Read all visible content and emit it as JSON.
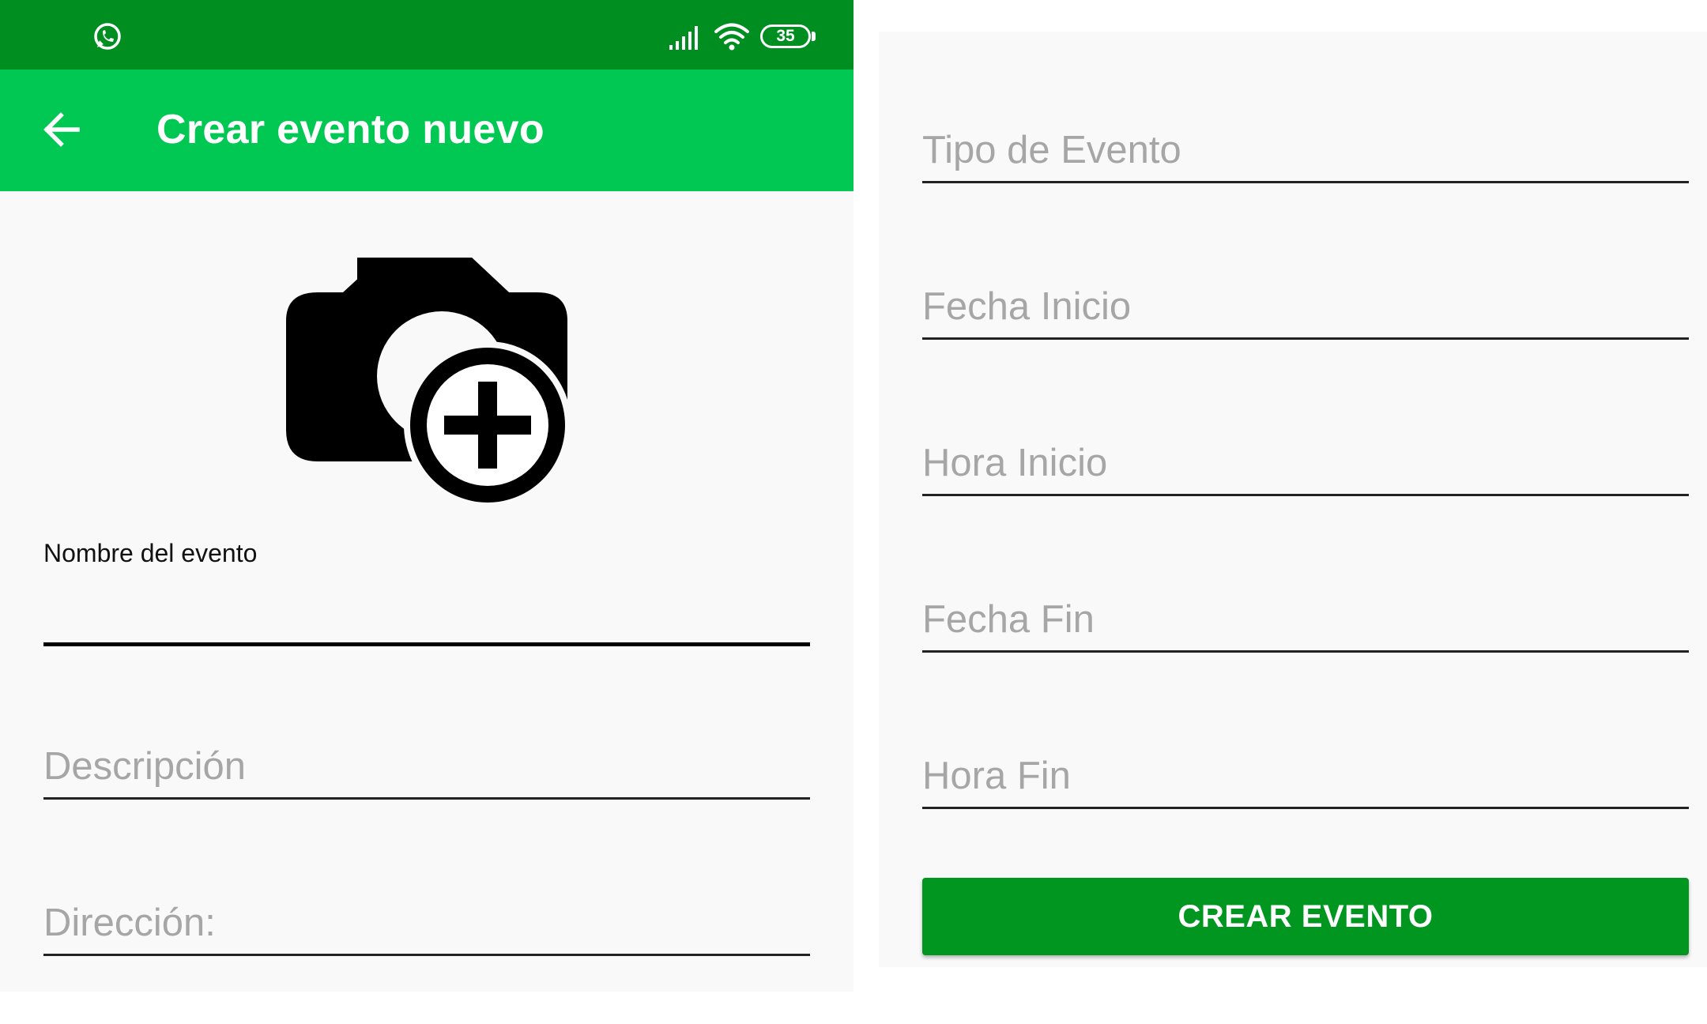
{
  "status_bar": {
    "battery_level": "35",
    "icons": [
      "whatsapp-icon",
      "signal-icon",
      "wifi-icon",
      "battery-icon"
    ]
  },
  "app_bar": {
    "title": "Crear evento nuevo",
    "back_icon": "arrow-left-icon"
  },
  "photo_picker": {
    "icon": "add-a-photo-icon"
  },
  "left_form": {
    "name_label": "Nombre del evento",
    "name_value": "",
    "description_placeholder": "Descripción",
    "address_placeholder": "Dirección:"
  },
  "right_form": {
    "type_placeholder": "Tipo de Evento",
    "start_date_placeholder": "Fecha Inicio",
    "start_time_placeholder": "Hora Inicio",
    "end_date_placeholder": "Fecha Fin",
    "end_time_placeholder": "Hora Fin",
    "submit_label": "CREAR EVENTO"
  },
  "colors": {
    "status_bar": "#008e20",
    "app_bar": "#00c853",
    "button": "#00961f",
    "background": "#f9f9f9",
    "placeholder": "#a6a6a6"
  }
}
